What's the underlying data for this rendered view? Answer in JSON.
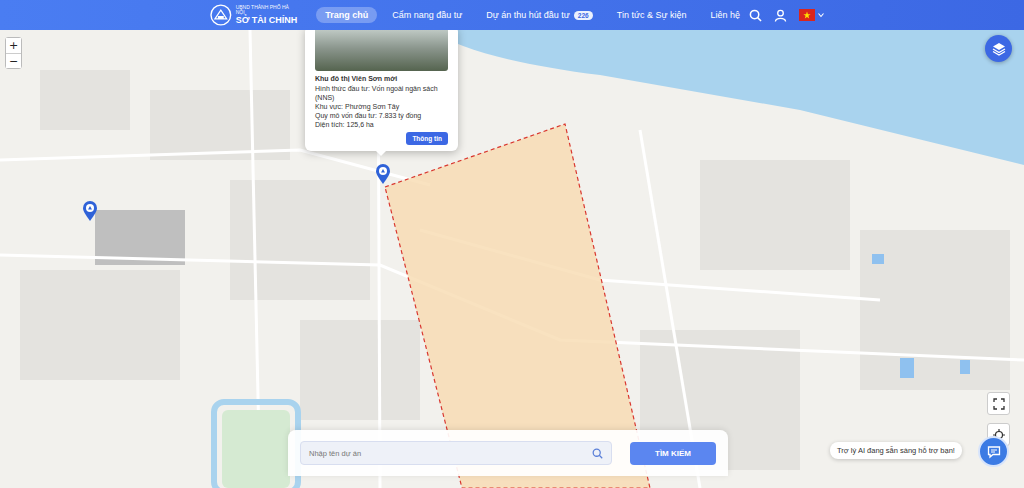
{
  "header": {
    "logo": {
      "subtitle": "UBND THÀNH PHỐ HÀ NỘI",
      "title": "SỞ TÀI CHÍNH"
    },
    "nav": [
      {
        "label": "Trang chủ",
        "selected": true
      },
      {
        "label": "Cẩm nang đầu tư",
        "selected": false
      },
      {
        "label": "Dự án thu hút đầu tư",
        "selected": false,
        "badge": "226"
      },
      {
        "label": "Tin tức & Sự kiện",
        "selected": false
      },
      {
        "label": "Liên hệ",
        "selected": false
      }
    ]
  },
  "map": {
    "zoom_in": "+",
    "zoom_out": "−"
  },
  "popup": {
    "title": "Khu đô thị Viên Sơn mới",
    "lines": [
      "Hình thức đầu tư: Vốn ngoài ngân sách (NNS)",
      "Khu vực: Phường Sơn Tây",
      "Quy mô vốn đầu tư: 7.833 tỷ đồng",
      "Diện tích: 125,6 ha"
    ],
    "button": "Thông tin"
  },
  "search": {
    "placeholder": "Nhập tên dự án",
    "button": "TÌM KIẾM"
  },
  "assistant": {
    "message": "Trợ lý AI đang sẵn sàng hỗ trợ bạn!"
  }
}
